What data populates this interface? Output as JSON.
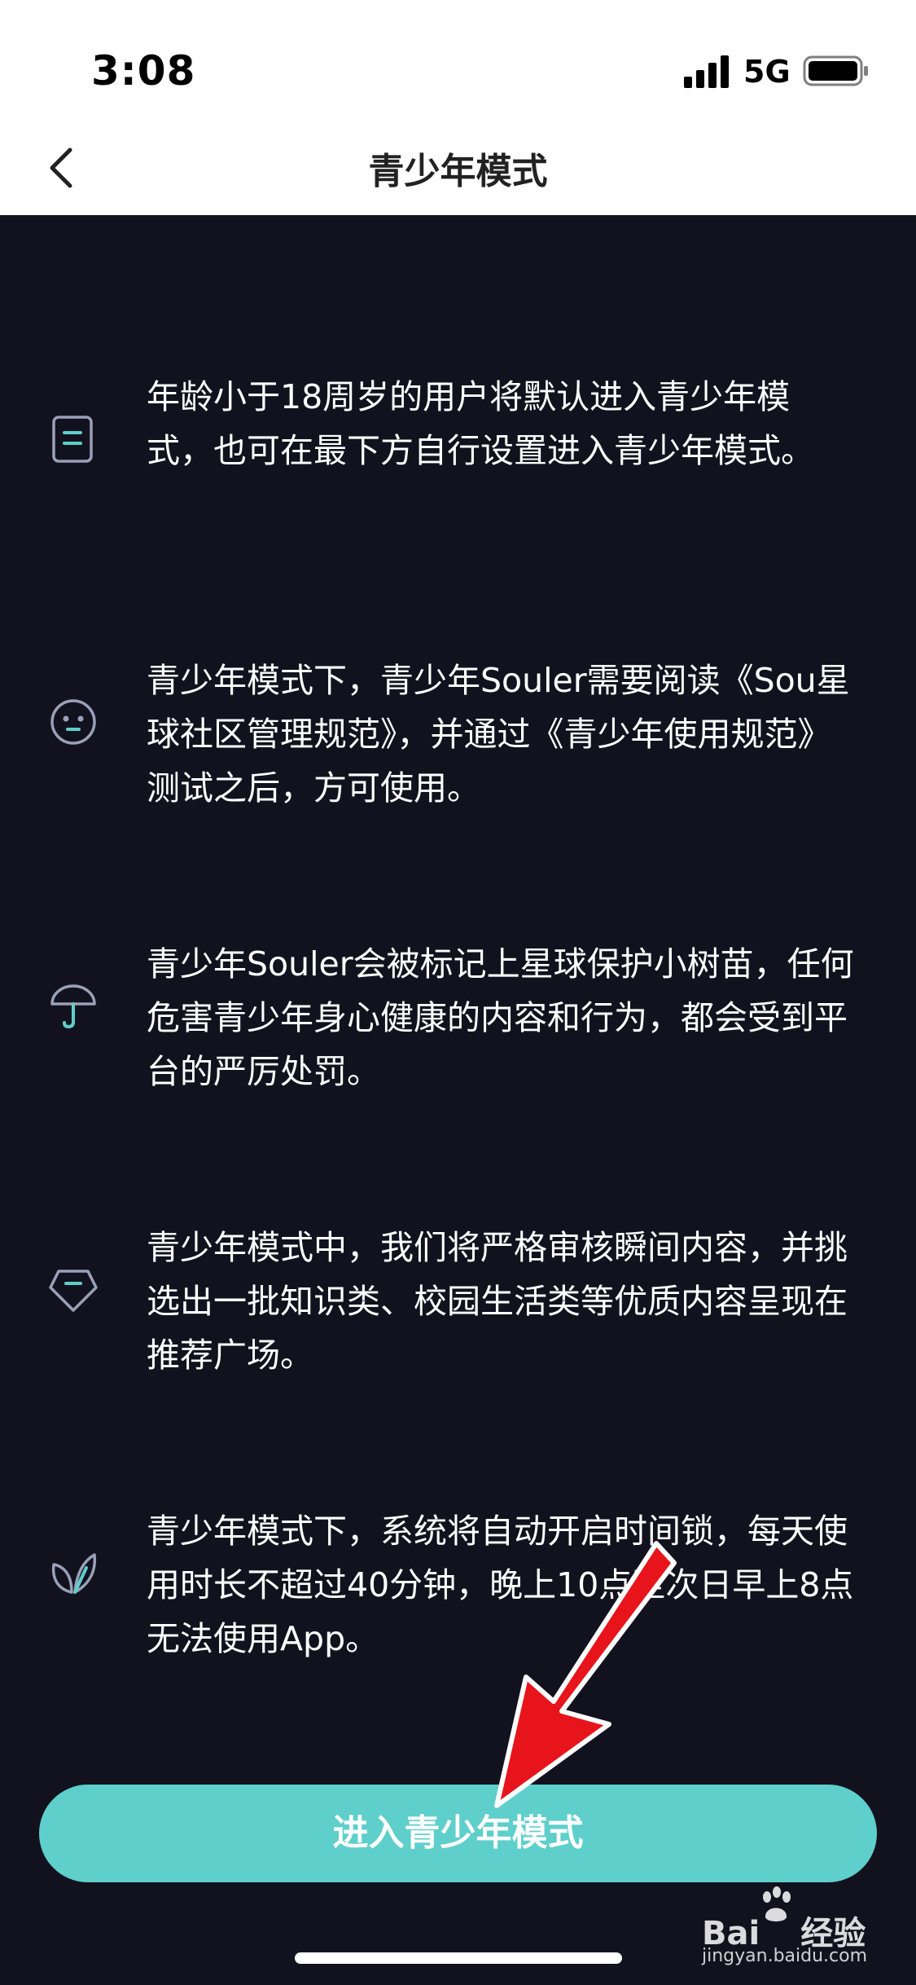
{
  "status_bar": {
    "time": "3:08",
    "network": "5G"
  },
  "nav": {
    "title": "青少年模式"
  },
  "rules": [
    {
      "icon": "document-icon",
      "text": "年龄小于18周岁的用户将默认进入青少年模式，也可在最下方自行设置进入青少年模式。"
    },
    {
      "icon": "smiley-face-icon",
      "text": "青少年模式下，青少年Souler需要阅读《Sou星球社区管理规范》，并通过《青少年使用规范》测试之后，方可使用。"
    },
    {
      "icon": "umbrella-icon",
      "text": "青少年Souler会被标记上星球保护小树苗，任何危害青少年身心健康的内容和行为，都会受到平台的严厉处罚。"
    },
    {
      "icon": "diamond-icon",
      "text": "青少年模式中，我们将严格审核瞬间内容，并挑选出一批知识类、校园生活类等优质内容呈现在推荐广场。"
    },
    {
      "icon": "leaf-icon",
      "text": "青少年模式下，系统将自动开启时间锁，每天使用时长不超过40分钟，晚上10点至次日早上8点无法使用App。"
    }
  ],
  "enter_button": {
    "label": "进入青少年模式"
  },
  "watermark": {
    "brand": "Bai",
    "brand_suffix": "经验",
    "site": "jingyan.baidu.com"
  },
  "colors": {
    "background": "#12121f",
    "accent": "#5ecfcb",
    "icon_stroke": "#9aa0b8",
    "arrow": "#e8141c"
  }
}
